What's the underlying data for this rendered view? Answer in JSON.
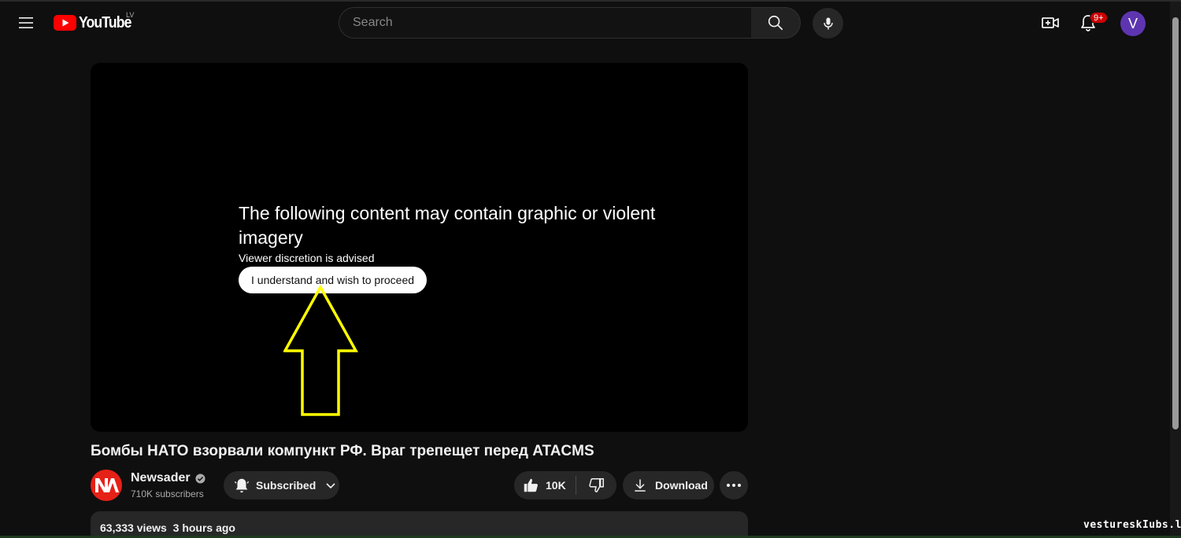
{
  "header": {
    "logo_text": "YouTube",
    "country_code": "LV",
    "search_placeholder": "Search",
    "notification_badge": "9+",
    "avatar_initial": "V"
  },
  "player": {
    "warning_title": "The following content may contain graphic or violent imagery",
    "warning_subtitle": "Viewer discretion is advised",
    "proceed_label": "I understand and wish to proceed"
  },
  "video": {
    "title": "Бомбы НАТО взорвали компункт РФ. Враг трепещет перед ATACMS",
    "channel_name": "Newsader",
    "subscribers": "710K subscribers",
    "subscribed_label": "Subscribed",
    "likes": "10K",
    "download_label": "Download",
    "views": "63,333 views",
    "uploaded": "3 hours ago"
  },
  "watermark": "vestureskIubs.lv",
  "colors": {
    "background": "#0f0f0f",
    "accent_red": "#ff0000",
    "avatar_purple": "#5e35b1",
    "arrow_yellow": "#ffff00",
    "button_surface": "#272727"
  }
}
